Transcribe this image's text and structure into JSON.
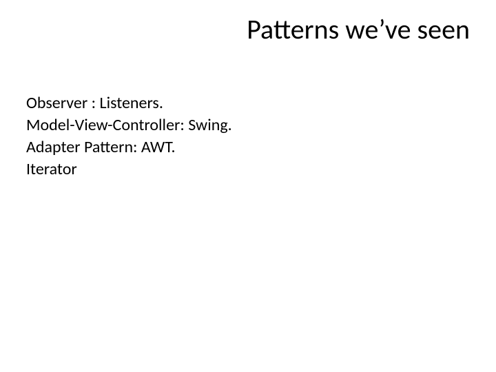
{
  "slide": {
    "title": "Patterns we’ve seen",
    "lines": [
      "Observer : Listeners.",
      "Model-View-Controller: Swing.",
      "Adapter Pattern: AWT.",
      "Iterator"
    ]
  }
}
